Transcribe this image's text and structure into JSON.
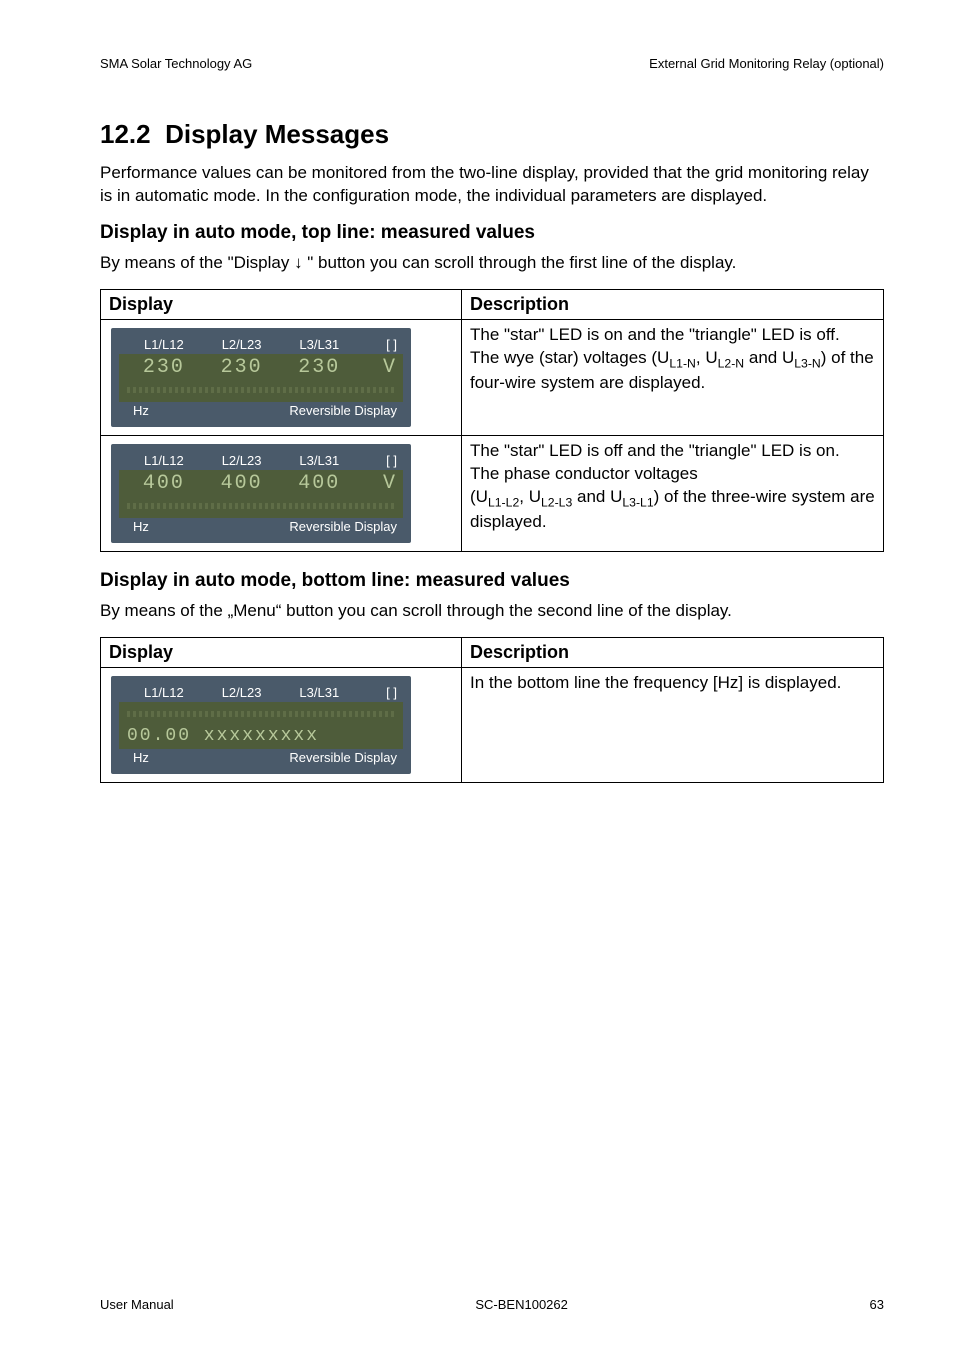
{
  "header": {
    "left": "SMA Solar Technology AG",
    "right": "External Grid Monitoring Relay (optional)"
  },
  "section": {
    "number": "12.2",
    "title": "Display Messages"
  },
  "intro": "Performance values can be monitored from the two-line display, provided that the grid monitoring relay is in automatic mode. In the configuration mode, the individual parameters are displayed.",
  "topBlock": {
    "heading": "Display in auto mode, top line: measured values",
    "lead": "By means of the \"Display  ↓  \" button you can scroll through the first line of the display.",
    "tableHeaders": {
      "display": "Display",
      "description": "Description"
    },
    "rows": [
      {
        "panel": {
          "labels": {
            "c1": "L1/L12",
            "c2": "L2/L23",
            "c3": "L3/L31",
            "c4": "[ ]"
          },
          "values": {
            "v1": "230",
            "v2": "230",
            "v3": "230",
            "unit": "V"
          },
          "bottom": {
            "left": "Hz",
            "right": "Reversible Display"
          }
        },
        "descHtml": "The \"star\" LED is on and the \"triangle\" LED is off.<br>The wye (star) voltages (U<sub>L1-N</sub>, U<sub>L2-N</sub> and U<sub>L3-N</sub>) of the four-wire system are displayed."
      },
      {
        "panel": {
          "labels": {
            "c1": "L1/L12",
            "c2": "L2/L23",
            "c3": "L3/L31",
            "c4": "[ ]"
          },
          "values": {
            "v1": "400",
            "v2": "400",
            "v3": "400",
            "unit": "V"
          },
          "bottom": {
            "left": "Hz",
            "right": "Reversible Display"
          }
        },
        "descHtml": "The \"star\" LED is off and the \"triangle\" LED is on.<br>The phase conductor voltages<br>(U<sub>L1-L2</sub>, U<sub>L2-L3</sub> and U<sub>L3-L1</sub>) of the three-wire system are displayed."
      }
    ]
  },
  "bottomBlock": {
    "heading": "Display in auto mode, bottom line: measured values",
    "lead": "By means of the „Menu“ button you can scroll through the second line of the display.",
    "tableHeaders": {
      "display": "Display",
      "description": "Description"
    },
    "rows": [
      {
        "panel": {
          "labels": {
            "c1": "L1/L12",
            "c2": "L2/L23",
            "c3": "L3/L31",
            "c4": "[ ]"
          },
          "bottomLine": "00.00 xxxxxxxxx",
          "bottom": {
            "left": "Hz",
            "right": "Reversible Display"
          }
        },
        "descHtml": "In the bottom line the frequency [Hz] is displayed."
      }
    ]
  },
  "footer": {
    "left": "User Manual",
    "center": "SC-BEN100262",
    "right": "63"
  },
  "chart_data": null
}
